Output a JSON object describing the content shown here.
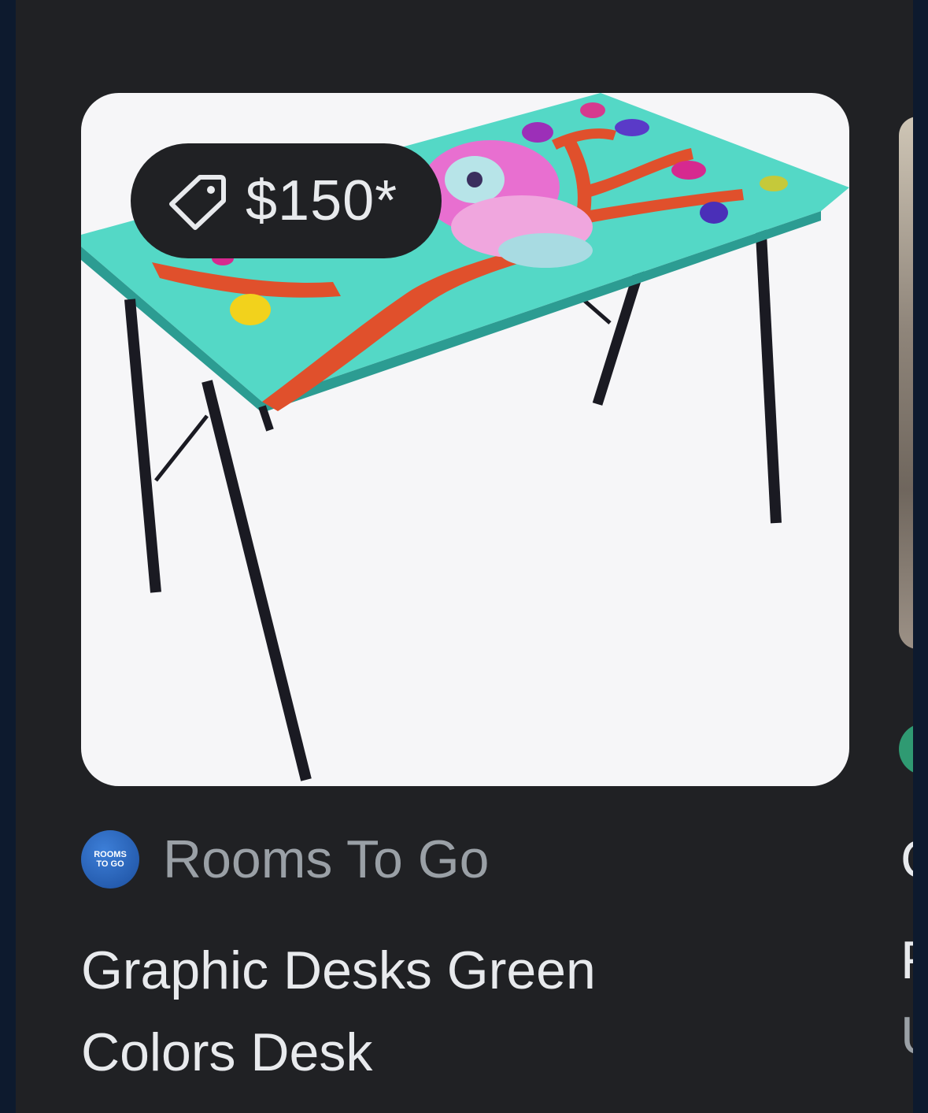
{
  "product_card": {
    "price": "$150*",
    "source": {
      "name": "Rooms To Go",
      "logo_line1": "ROOMS",
      "logo_line2": "TO GO"
    },
    "title": "Graphic Desks Green Colors Desk"
  },
  "next_card": {
    "line1": "C",
    "line2": "F",
    "line3": "U"
  },
  "colors": {
    "background": "#202124",
    "image_background": "#f6f6f8",
    "desk_top": "#54d8c6",
    "tree": "#e0502c",
    "text_primary": "#e8eaed",
    "text_secondary": "#9aa0a6"
  },
  "icons": {
    "price_tag": "tag-icon",
    "source_logo": "rooms-to-go-logo"
  }
}
